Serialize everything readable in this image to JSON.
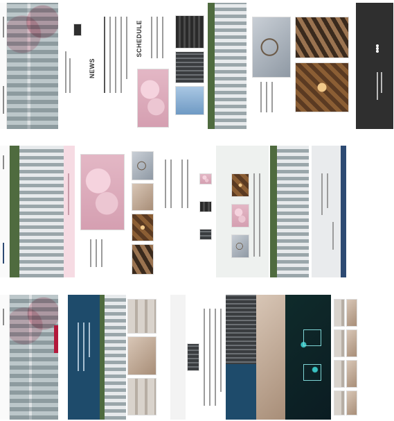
{
  "pages": [
    {
      "id": "page-1",
      "labels": {
        "news": "NEWS",
        "schedule": "SCHEDULE"
      }
    },
    {
      "id": "page-2"
    },
    {
      "id": "page-3"
    }
  ],
  "colors": {
    "navy": "#1e4b6b",
    "pink": "#f6dbe3",
    "dark_footer": "#2f2f2f",
    "muted_blue": "#2d4a73",
    "accent_red": "#b3193b"
  }
}
